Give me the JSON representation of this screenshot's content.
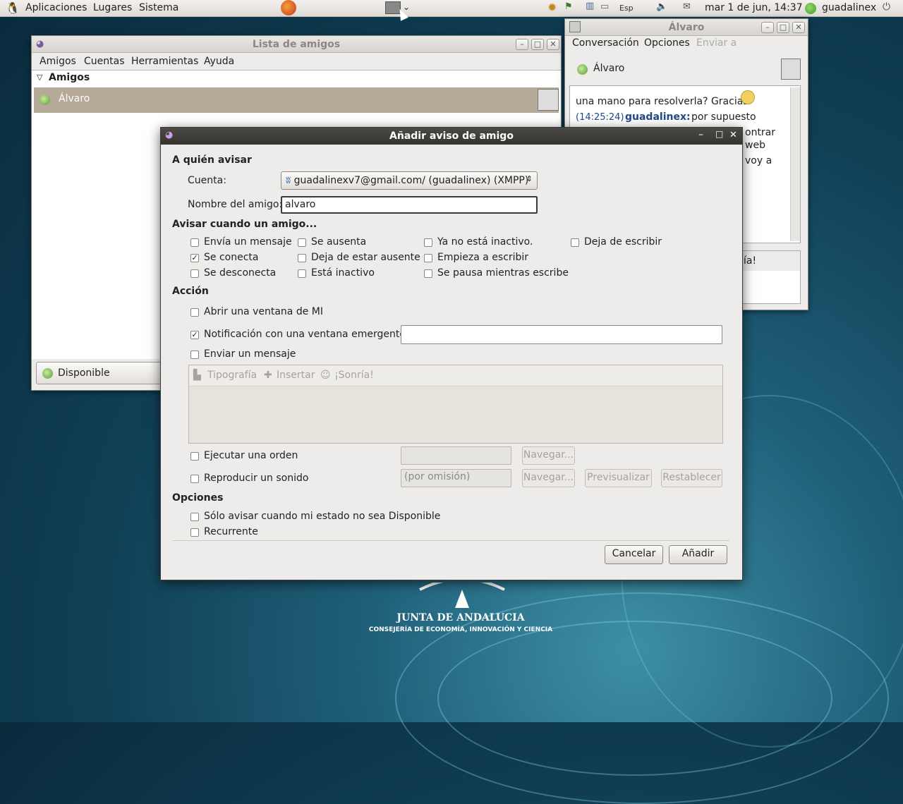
{
  "panel": {
    "menus": [
      "Aplicaciones",
      "Lugares",
      "Sistema"
    ],
    "keyboard": "Esp",
    "clock": "mar  1 de jun, 14:37",
    "user": "guadalinex"
  },
  "buddy_list": {
    "title": "Lista de amigos",
    "menus": [
      "Amigos",
      "Cuentas",
      "Herramientas",
      "Ayuda"
    ],
    "group": "Amigos",
    "buddy": "Álvaro",
    "status": "Disponible"
  },
  "conversation": {
    "title": "Álvaro",
    "menus": [
      "Conversación",
      "Opciones",
      "Enviar a"
    ],
    "buddy": "Álvaro",
    "message1": "una mano para resolverla? Gracias",
    "time2": "(14:25:24)",
    "sender2": "guadalinex:",
    "message2": "por supuesto",
    "frag1": "ontrar",
    "frag2": "web",
    "frag3": "voy a",
    "frag4": "ía!"
  },
  "dialog": {
    "title": "Añadir aviso de amigo",
    "section_who": "A quién avisar",
    "account_label": "Cuenta:",
    "account_value": "guadalinexv7@gmail.com/ (guadalinex) (XMPP)",
    "buddy_label": "Nombre del amigo:",
    "buddy_value": "alvaro",
    "section_when": "Avisar cuando un amigo...",
    "events": {
      "sends_message": "Envía un mensaje",
      "signs_on": "Se conecta",
      "signs_off": "Se desconecta",
      "goes_away": "Se ausenta",
      "returns": "Deja de estar ausente",
      "goes_idle": "Está inactivo",
      "no_longer_idle": "Ya no está inactivo.",
      "starts_typing": "Empieza a escribir",
      "pauses_typing": "Se pausa mientras escribe",
      "stops_typing": "Deja de escribir"
    },
    "section_action": "Acción",
    "actions": {
      "open_window": "Abrir una ventana de MI",
      "popup": "Notificación con una ventana emergente",
      "send_message": "Enviar un mensaje",
      "execute": "Ejecutar una orden",
      "play_sound": "Reproducir un sonido"
    },
    "toolbar": {
      "font": "Tipografía",
      "insert": "Insertar",
      "smile": "¡Sonría!"
    },
    "browse": "Navegar...",
    "sound_value": "(por omisión)",
    "preview": "Previsualizar",
    "reset": "Restablecer",
    "section_options": "Opciones",
    "options": {
      "only_available": "Sólo avisar cuando mi estado no sea Disponible",
      "recurring": "Recurrente"
    },
    "cancel": "Cancelar",
    "add": "Añadir"
  },
  "desktop": {
    "logo_line1": "JUNTA DE ANDALUCIA",
    "logo_line2": "CONSEJERÍA DE ECONOMÍA, INNOVACIÓN Y CIENCIA"
  }
}
